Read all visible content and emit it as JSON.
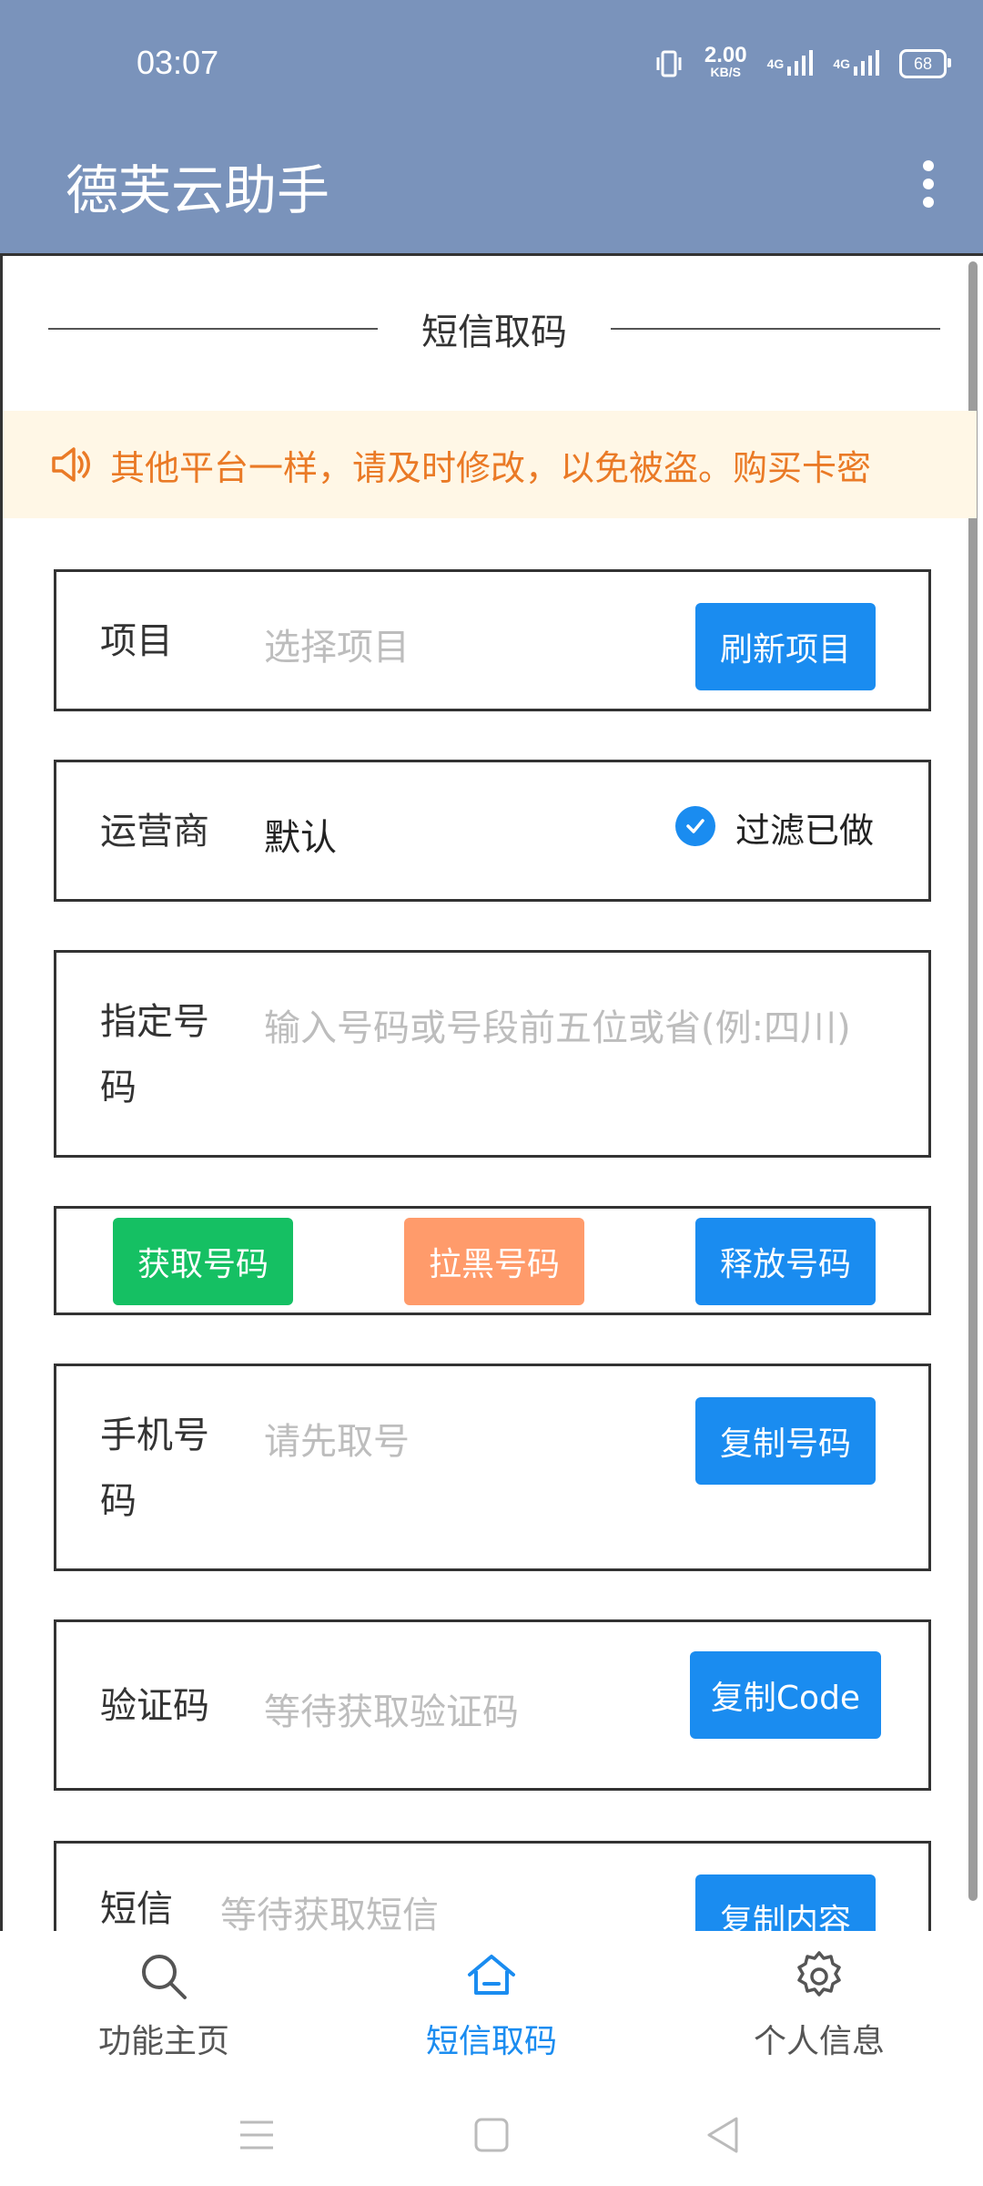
{
  "status": {
    "time": "03:07",
    "speed": "2.00",
    "speed_unit": "KB/S",
    "net1": "4G",
    "net2": "4G",
    "battery": "68"
  },
  "appbar": {
    "title": "德芙云助手"
  },
  "section": {
    "title": "短信取码"
  },
  "notice": {
    "text": "其他平台一样，请及时修改，以免被盗。购买卡密"
  },
  "project": {
    "label": "项目",
    "placeholder": "选择项目",
    "button": "刷新项目"
  },
  "operator": {
    "label": "运营商",
    "value": "默认",
    "filter": "过滤已做"
  },
  "designated": {
    "label": "指定号码",
    "placeholder": "输入号码或号段前五位或省(例:四川)"
  },
  "actions": {
    "get": "获取号码",
    "blacklist": "拉黑号码",
    "release": "释放号码"
  },
  "phone": {
    "label": "手机号码",
    "placeholder": "请先取号",
    "button": "复制号码"
  },
  "code": {
    "label": "验证码",
    "placeholder": "等待获取验证码",
    "button": "复制Code"
  },
  "sms": {
    "label": "短信",
    "placeholder": "等待获取短信",
    "button": "复制内容"
  },
  "nav": [
    {
      "label": "功能主页",
      "icon": "search-icon"
    },
    {
      "label": "短信取码",
      "icon": "home-icon"
    },
    {
      "label": "个人信息",
      "icon": "gear-icon"
    }
  ],
  "colors": {
    "accent": "#1a8cf0",
    "bar": "#7a93bb",
    "green": "#15c063",
    "salmon": "#ff9b6b",
    "notice": "#ea7a26"
  }
}
